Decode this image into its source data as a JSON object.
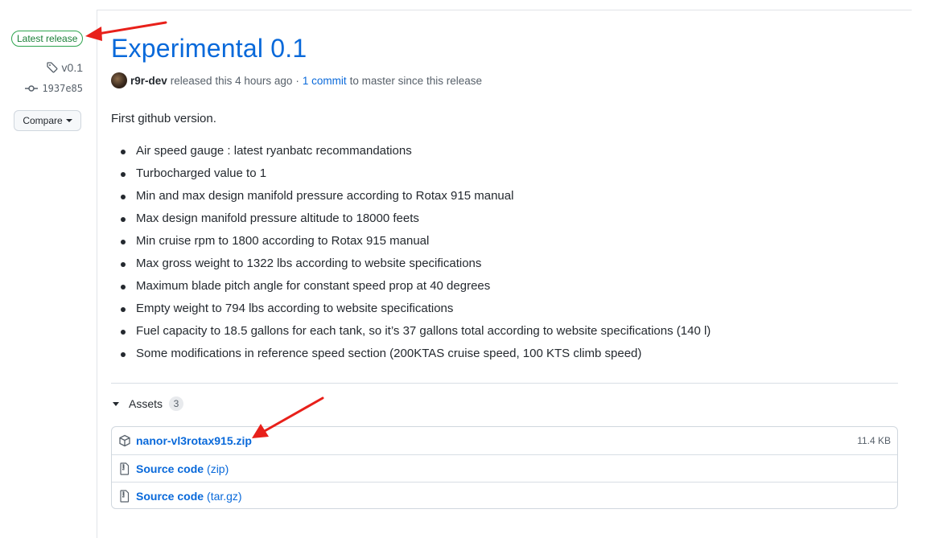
{
  "sidebar": {
    "badge": "Latest release",
    "tag": "v0.1",
    "commit": "1937e85",
    "compare_label": "Compare"
  },
  "release": {
    "title": "Experimental 0.1",
    "author": "r9r-dev",
    "released_text": "released this 4 hours ago",
    "separator": "·",
    "commits_link": "1 commit",
    "commits_suffix": "to master since this release",
    "intro": "First github version.",
    "changes": [
      "Air speed gauge : latest ryanbatc recommandations",
      "Turbocharged value to 1",
      "Min and max design manifold pressure according to Rotax 915 manual",
      "Max design manifold pressure altitude to 18000 feets",
      "Min cruise rpm to 1800 according to Rotax 915 manual",
      "Max gross weight to 1322 lbs according to website specifications",
      "Maximum blade pitch angle for constant speed prop at 40 degrees",
      "Empty weight to 794 lbs according to website specifications",
      "Fuel capacity to 18.5 gallons for each tank, so it’s 37 gallons total according to website specifications (140 l)",
      "Some modifications in reference speed section (200KTAS cruise speed, 100 KTS climb speed)"
    ]
  },
  "assets": {
    "label": "Assets",
    "count": "3",
    "items": [
      {
        "name": "nanor-vl3rotax915.zip",
        "format": "",
        "size": "11.4 KB",
        "icon": "package-icon"
      },
      {
        "name": "Source code",
        "format": "(zip)",
        "size": "",
        "icon": "file-zip-icon"
      },
      {
        "name": "Source code",
        "format": "(tar.gz)",
        "size": "",
        "icon": "file-zip-icon"
      }
    ]
  },
  "colors": {
    "link": "#0969da",
    "badge_green": "#1a7f37",
    "annotation_arrow": "#e8201a"
  }
}
